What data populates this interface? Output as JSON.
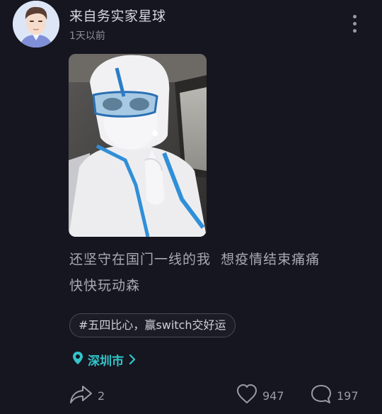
{
  "post": {
    "author_name": "来自务实家星球",
    "time": "1天以前",
    "text_lines": [
      "还坚守在国门一线的我  想疫情结束痛痛",
      "快快玩动森"
    ],
    "topic": "#五四比心，赢switch交好运",
    "location": "深圳市"
  },
  "actions": {
    "share_count": "2",
    "like_count": "947",
    "comment_count": "197"
  },
  "icons": {
    "more": "more-vertical-icon",
    "location": "location-pin-icon",
    "chevron": "chevron-right-icon",
    "share": "share-arrow-icon",
    "like": "heart-icon",
    "comment": "comment-bubble-icon"
  },
  "colors": {
    "background": "#161620",
    "accent": "#32c5c9"
  }
}
